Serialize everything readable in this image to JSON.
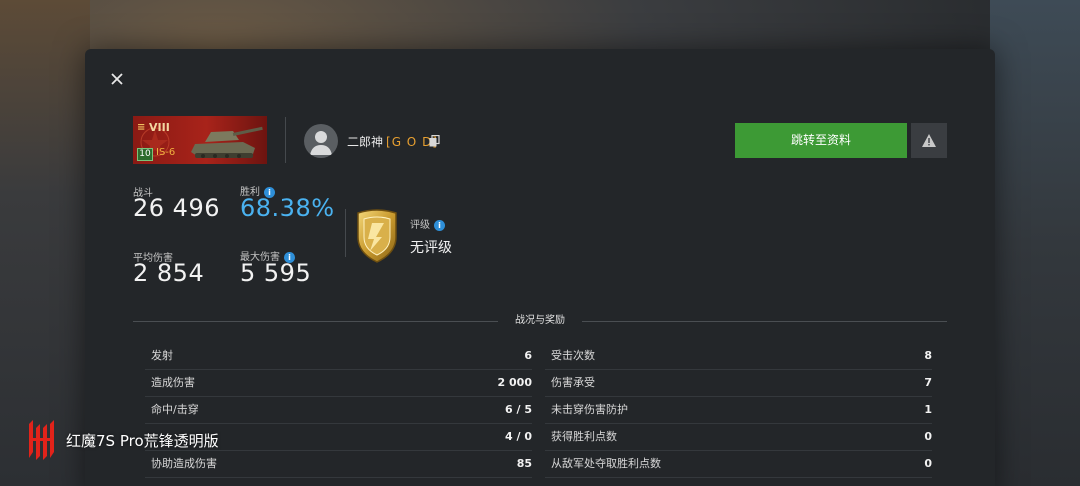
{
  "tank": {
    "tier_roman": "VIII",
    "level": "10",
    "name": "IS-6"
  },
  "player": {
    "name": "二郎神",
    "clan": "[G O D]"
  },
  "buttons": {
    "goto_profile": "跳转至资料"
  },
  "stats": {
    "battles_label": "战斗",
    "battles_value": "26 496",
    "winrate_label": "胜利",
    "winrate_value": "68.38%",
    "avg_damage_label": "平均伤害",
    "avg_damage_value": "2 854",
    "max_damage_label": "最大伤害",
    "max_damage_value": "5 595"
  },
  "rating": {
    "label": "评级",
    "value": "无评级"
  },
  "section": {
    "title": "战况与奖励"
  },
  "details_left": [
    {
      "label": "发射",
      "value": "6"
    },
    {
      "label": "造成伤害",
      "value": "2 000"
    },
    {
      "label": "命中/击穿",
      "value": "6 / 5"
    },
    {
      "label": "",
      "value": "4 / 0"
    },
    {
      "label": "协助造成伤害",
      "value": "85"
    }
  ],
  "details_right": [
    {
      "label": "受击次数",
      "value": "8"
    },
    {
      "label": "伤害承受",
      "value": "7"
    },
    {
      "label": "未击穿伤害防护",
      "value": "1"
    },
    {
      "label": "获得胜利点数",
      "value": "0"
    },
    {
      "label": "从敌军处夺取胜利点数",
      "value": "0"
    }
  ],
  "watermark": {
    "text": "红魔7S Pro荒锋透明版"
  },
  "colors": {
    "accent_green": "#3d9a35",
    "winrate_blue": "#4ab2f0",
    "clan_orange": "#e8a030",
    "tank_red": "#a8231a"
  }
}
